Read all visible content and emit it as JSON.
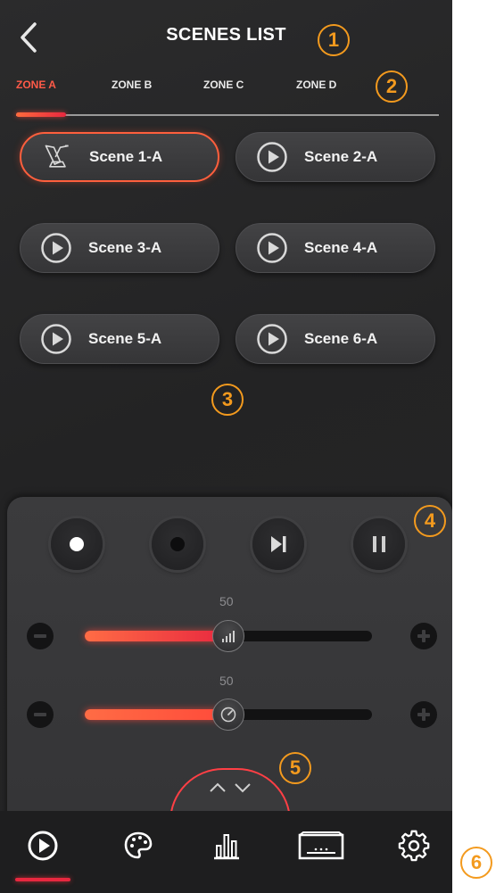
{
  "header": {
    "title": "SCENES LIST"
  },
  "tabs": [
    {
      "label": "ZONE A",
      "active": true
    },
    {
      "label": "ZONE B",
      "active": false
    },
    {
      "label": "ZONE C",
      "active": false
    },
    {
      "label": "ZONE D",
      "active": false
    }
  ],
  "scenes": [
    {
      "label": "Scene 1-A",
      "icon": "spotlight-icon",
      "active": true
    },
    {
      "label": "Scene 2-A",
      "icon": "play-circle-icon",
      "active": false
    },
    {
      "label": "Scene 3-A",
      "icon": "play-circle-icon",
      "active": false
    },
    {
      "label": "Scene 4-A",
      "icon": "play-circle-icon",
      "active": false
    },
    {
      "label": "Scene 5-A",
      "icon": "play-circle-icon",
      "active": false
    },
    {
      "label": "Scene 6-A",
      "icon": "play-circle-icon",
      "active": false
    }
  ],
  "playback": {
    "controls": [
      {
        "name": "record-white",
        "icon": "record-dot-icon"
      },
      {
        "name": "record-dark",
        "icon": "record-dot-icon"
      },
      {
        "name": "skip-next",
        "icon": "skip-next-icon"
      },
      {
        "name": "pause",
        "icon": "pause-icon"
      }
    ]
  },
  "sliders": {
    "brightness": {
      "value": "50",
      "fraction": 0.5,
      "icon": "signal-bars-icon"
    },
    "speed": {
      "value": "50",
      "fraction": 0.5,
      "icon": "speedometer-icon"
    }
  },
  "badges": [
    "1",
    "2",
    "3",
    "4",
    "5",
    "6"
  ],
  "nav": {
    "items": [
      {
        "name": "play",
        "icon": "play-circle-icon",
        "active": true
      },
      {
        "name": "palette",
        "icon": "palette-icon",
        "active": false
      },
      {
        "name": "equalizer",
        "icon": "bar-chart-icon",
        "active": false
      },
      {
        "name": "stage",
        "icon": "stage-icon",
        "active": false
      },
      {
        "name": "settings",
        "icon": "gear-icon",
        "active": false
      }
    ]
  },
  "colors": {
    "accent": "#ff5a48",
    "accent_red": "#e8283f",
    "annotation": "#f39a1e",
    "background": "#262627"
  }
}
